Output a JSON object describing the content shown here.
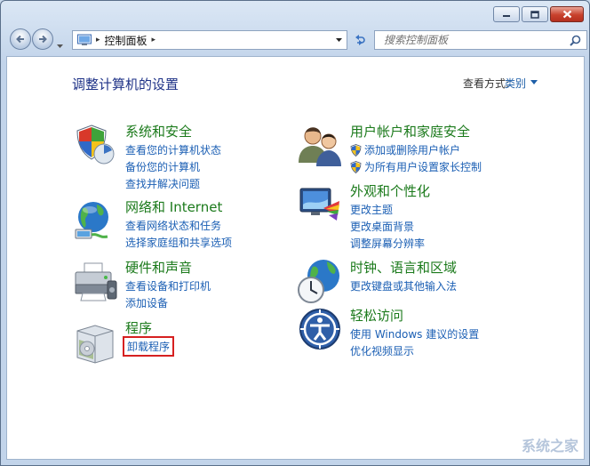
{
  "address": {
    "crumb": "控制面板",
    "separator": "▸"
  },
  "search": {
    "placeholder": "搜索控制面板"
  },
  "main": {
    "heading": "调整计算机的设置",
    "view_by_label": "查看方式:",
    "view_by_value": "类别"
  },
  "categories": {
    "system": {
      "title": "系统和安全",
      "links": [
        "查看您的计算机状态",
        "备份您的计算机",
        "查找并解决问题"
      ]
    },
    "network": {
      "title": "网络和 Internet",
      "links": [
        "查看网络状态和任务",
        "选择家庭组和共享选项"
      ]
    },
    "hardware": {
      "title": "硬件和声音",
      "links": [
        "查看设备和打印机",
        "添加设备"
      ]
    },
    "programs": {
      "title": "程序",
      "links": [
        "卸载程序"
      ]
    },
    "users": {
      "title": "用户帐户和家庭安全",
      "links": [
        "添加或删除用户帐户",
        "为所有用户设置家长控制"
      ]
    },
    "appearance": {
      "title": "外观和个性化",
      "links": [
        "更改主题",
        "更改桌面背景",
        "调整屏幕分辨率"
      ]
    },
    "clock": {
      "title": "时钟、语言和区域",
      "links": [
        "更改键盘或其他输入法"
      ]
    },
    "ease": {
      "title": "轻松访问",
      "links": [
        "使用 Windows 建议的设置",
        "优化视频显示"
      ]
    }
  },
  "watermark": "系统之家",
  "colors": {
    "link": "#1b5fb4",
    "category_title": "#1b7a1b",
    "heading": "#1e3287",
    "highlight_box": "#d62020"
  }
}
